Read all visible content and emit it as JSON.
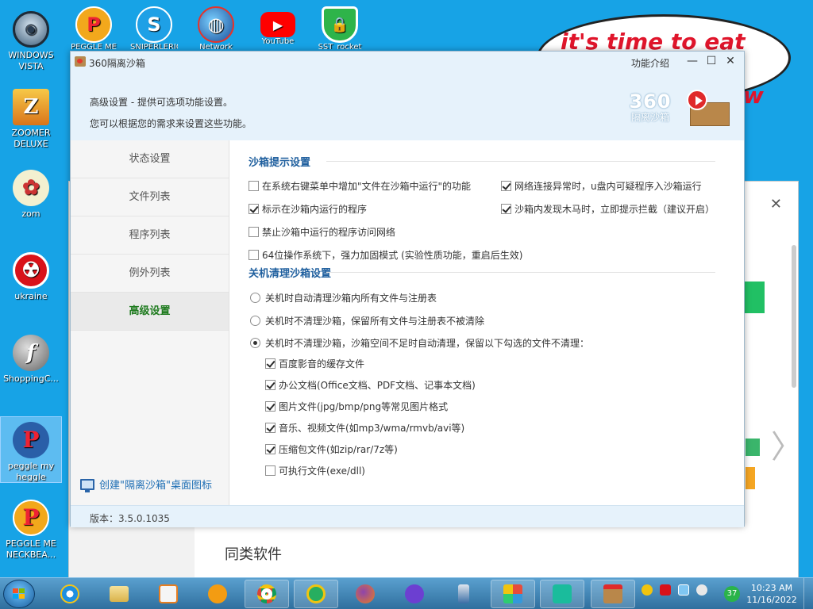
{
  "desktop": {
    "icons": [
      {
        "label": "WINDOWS VISTA"
      },
      {
        "label": "ZOOMER DELUXE"
      },
      {
        "label": "zom"
      },
      {
        "label": "ukraine"
      },
      {
        "label": "ShoppingC..."
      },
      {
        "label": "peggle my heggle"
      },
      {
        "label": "PEGGLE ME NECKBEA..."
      }
    ],
    "top_icons": [
      {
        "label": "PEGGLE ME"
      },
      {
        "label": "SNIPERLERIG"
      },
      {
        "label": "Network"
      },
      {
        "label": "YouTube"
      },
      {
        "label": "SST_rocket"
      }
    ],
    "bubble": {
      "line1": "it's time to eat shit",
      "line2": "w"
    }
  },
  "background_window": {
    "section_label": "同类软件",
    "close_glyph": "✕",
    "next_glyph": "〉"
  },
  "dialog": {
    "title": "360隔离沙箱",
    "feature_link": "功能介绍",
    "controls": {
      "minimize": "—",
      "maximize": "☐",
      "close": "✕"
    },
    "header": {
      "line1": "高级设置 - 提供可选项功能设置。",
      "line2": "您可以根据您的需求来设置这些功能。"
    },
    "logo": {
      "number": "360",
      "subtitle": "隔离沙箱"
    },
    "sidebar": {
      "items": [
        {
          "label": "状态设置",
          "active": false
        },
        {
          "label": "文件列表",
          "active": false
        },
        {
          "label": "程序列表",
          "active": false
        },
        {
          "label": "例外列表",
          "active": false
        },
        {
          "label": "高级设置",
          "active": true
        }
      ],
      "create_shortcut": "创建\"隔离沙箱\"桌面图标"
    },
    "sections": {
      "prompt": {
        "title": "沙箱提示设置",
        "options": [
          {
            "label": "在系统右键菜单中增加\"文件在沙箱中运行\"的功能",
            "checked": false
          },
          {
            "label": "网络连接异常时，u盘内可疑程序入沙箱运行",
            "checked": true
          },
          {
            "label": "标示在沙箱内运行的程序",
            "checked": true
          },
          {
            "label": "沙箱内发现木马时，立即提示拦截（建议开启）",
            "checked": true
          },
          {
            "label": "禁止沙箱中运行的程序访问网络",
            "checked": false
          },
          {
            "label": "64位操作系统下，强力加固模式 (实验性质功能，重启后生效)",
            "checked": false
          }
        ]
      },
      "shutdown": {
        "title": "关机清理沙箱设置",
        "radios": [
          {
            "label": "关机时自动清理沙箱内所有文件与注册表",
            "checked": false
          },
          {
            "label": "关机时不清理沙箱，保留所有文件与注册表不被清除",
            "checked": false
          },
          {
            "label": "关机时不清理沙箱，沙箱空间不足时自动清理，保留以下勾选的文件不清理：",
            "checked": true
          }
        ],
        "keep_files": [
          {
            "label": "百度影音的缓存文件",
            "checked": true
          },
          {
            "label": "办公文档(Office文档、PDF文档、记事本文档)",
            "checked": true
          },
          {
            "label": "图片文件(jpg/bmp/png等常见图片格式",
            "checked": true
          },
          {
            "label": "音乐、视频文件(如mp3/wma/rmvb/avi等)",
            "checked": true
          },
          {
            "label": "压缩包文件(如zip/rar/7z等)",
            "checked": true
          },
          {
            "label": "可执行文件(exe/dll)",
            "checked": false
          }
        ]
      }
    },
    "footer": {
      "version": "版本：3.5.0.1035"
    }
  },
  "taskbar": {
    "clock_time": "10:23 AM",
    "clock_date": "11/16/2022",
    "tray_badge": "37"
  }
}
